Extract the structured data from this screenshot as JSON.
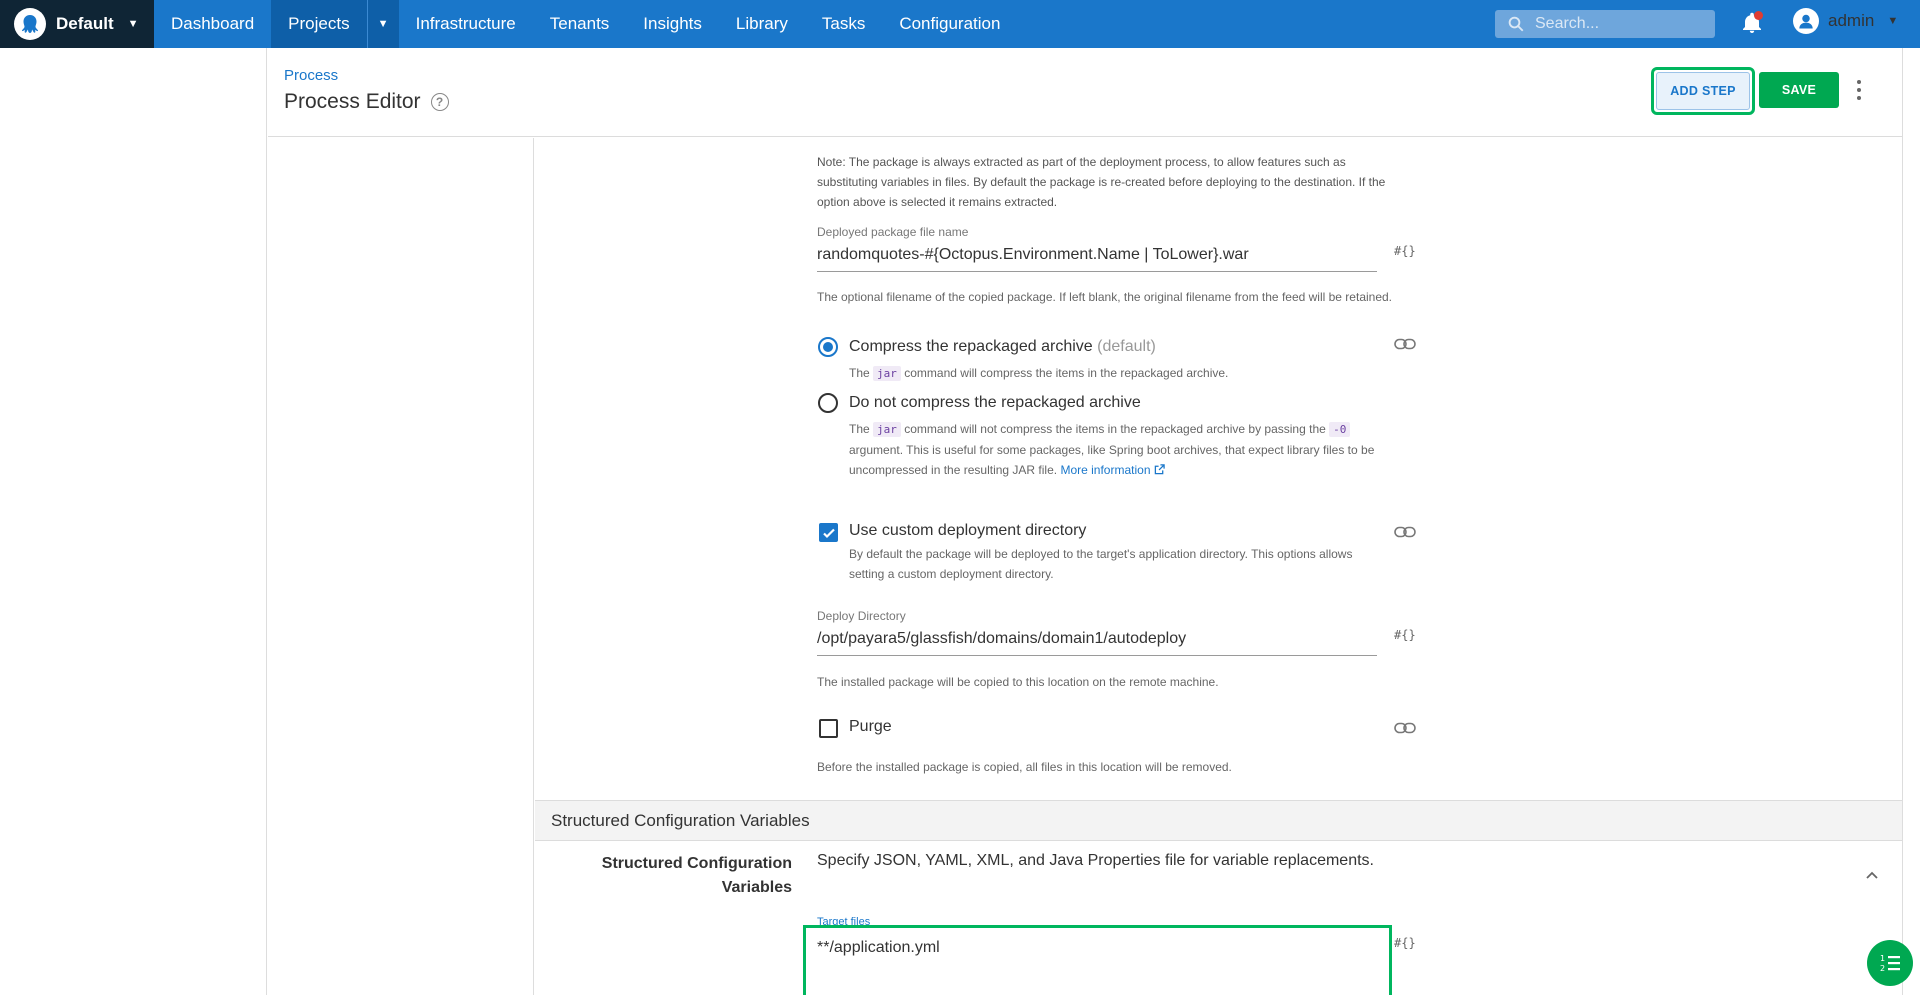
{
  "topnav": {
    "space_name": "Default",
    "items": [
      "Dashboard",
      "Projects",
      "Infrastructure",
      "Tenants",
      "Insights",
      "Library",
      "Tasks",
      "Configuration"
    ],
    "search_placeholder": "Search...",
    "user": "admin"
  },
  "header": {
    "breadcrumb": "Process",
    "title": "Process Editor",
    "add_step_label": "ADD STEP",
    "save_label": "SAVE"
  },
  "package": {
    "note": "Note: The package is always extracted as part of the deployment process, to allow features such as substituting variables in files. By default the package is re-created before deploying to the destination. If the option above is selected it remains extracted.",
    "file_name_label": "Deployed package file name",
    "file_name_value": "randomquotes-#{Octopus.Environment.Name | ToLower}.war",
    "file_name_hint": "The optional filename of the copied package. If left blank, the original filename from the feed will be retained.",
    "var_icon": "#{}"
  },
  "compression": {
    "option1_label": "Compress the repackaged archive",
    "option1_default": "(default)",
    "option1_hint_pre": "The",
    "option1_hint_code": "jar",
    "option1_hint_post": "command will compress the items in the repackaged archive.",
    "option2_label": "Do not compress the repackaged archive",
    "option2_hint_pre": "The",
    "option2_hint_code": "jar",
    "option2_hint_mid": "command will not compress the items in the repackaged archive by passing the",
    "option2_hint_flag": "-0",
    "option2_hint_post": "argument. This is useful for some packages, like Spring boot archives, that expect library files to be uncompressed in the resulting JAR file.",
    "more_info": "More information"
  },
  "custom_dir": {
    "label": "Use custom deployment directory",
    "hint": "By default the package will be deployed to the target's application directory. This options allows setting a custom deployment directory.",
    "checked": true
  },
  "deploy_dir": {
    "label": "Deploy Directory",
    "value": "/opt/payara5/glassfish/domains/domain1/autodeploy",
    "hint": "The installed package will be copied to this location on the remote machine."
  },
  "purge": {
    "label": "Purge",
    "hint": "Before the installed package is copied, all files in this location will be removed.",
    "checked": false
  },
  "structured": {
    "section_title": "Structured Configuration Variables",
    "label_line1": "Structured Configuration",
    "label_line2": "Variables",
    "description": "Specify JSON, YAML, XML, and Java Properties file for variable replacements.",
    "target_label": "Target files",
    "target_value": "**/application.yml"
  },
  "colors": {
    "nav_bg": "#1a77ca",
    "space_bg": "#0f2535",
    "accent": "#1a77ca",
    "save_green": "#00a851",
    "highlight_green": "#00b65e"
  },
  "icons": [
    "octopus-logo-icon",
    "caret-down-icon",
    "search-icon",
    "bell-icon",
    "user-avatar-icon",
    "help-icon",
    "kebab-menu-icon",
    "link-icon",
    "external-link-icon",
    "chevron-up-icon",
    "list-icon"
  ]
}
